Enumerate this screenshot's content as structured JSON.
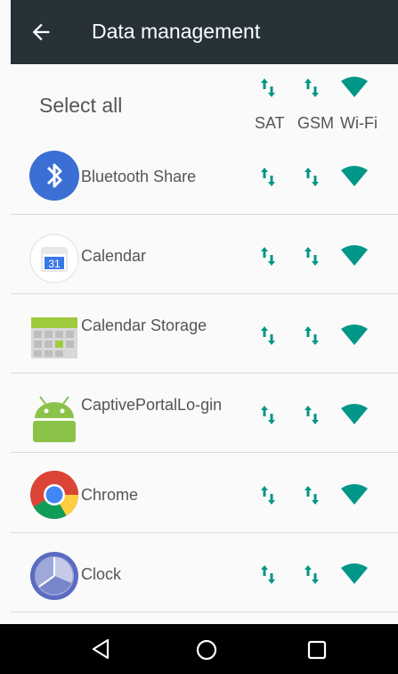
{
  "header": {
    "title": "Data management",
    "back_icon": "arrow-back-icon"
  },
  "columns": {
    "select_all": "Select all",
    "labels": [
      "SAT",
      "GSM",
      "Wi-Fi"
    ]
  },
  "apps": [
    {
      "name": "Bluetooth Share",
      "icon": "bluetooth-icon"
    },
    {
      "name": "Calendar",
      "icon": "calendar-icon",
      "badge": "31"
    },
    {
      "name": "Calendar Storage",
      "icon": "calendar-storage-icon"
    },
    {
      "name": "CaptivePortalLo-gin",
      "icon": "android-icon"
    },
    {
      "name": "Chrome",
      "icon": "chrome-icon"
    },
    {
      "name": "Clock",
      "icon": "clock-icon"
    }
  ],
  "colors": {
    "accent": "#009688",
    "appbar": "#263238",
    "text": "#555555"
  },
  "navbar": {
    "icons": [
      "back-triangle-icon",
      "home-circle-icon",
      "recents-square-icon"
    ]
  }
}
